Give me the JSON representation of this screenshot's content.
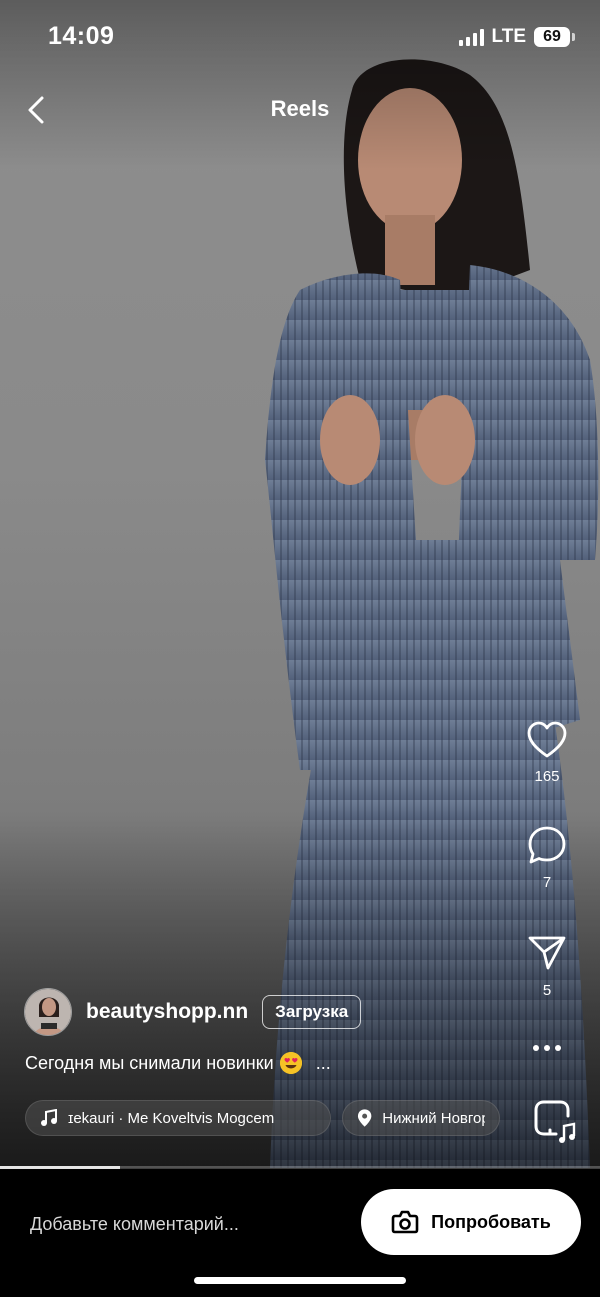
{
  "status_bar": {
    "time": "14:09",
    "network": "LTE",
    "battery": "69"
  },
  "header": {
    "title": "Reels",
    "back_icon": "chevron-left-icon"
  },
  "actions": {
    "like": {
      "icon": "heart-icon",
      "count": "165"
    },
    "comment": {
      "icon": "comment-icon",
      "count": "7"
    },
    "share": {
      "icon": "paper-plane-icon",
      "count": "5"
    },
    "more": {
      "icon": "more-horizontal-icon"
    },
    "remix": {
      "icon": "remix-audio-icon"
    }
  },
  "post": {
    "username": "beautyshopp.nn",
    "follow_label": "Загрузка",
    "caption": "Сегодня мы снимали новинки",
    "caption_emoji": "heart-eyes-emoji",
    "caption_more": "...",
    "audio": "ɪekauri · Me Koveltvis Mogcem",
    "location": "Нижний Новгор"
  },
  "progress": {
    "fraction": 0.2
  },
  "comment": {
    "placeholder": "Добавьте комментарий..."
  },
  "cta": {
    "label": "Попробовать",
    "icon": "camera-icon"
  }
}
